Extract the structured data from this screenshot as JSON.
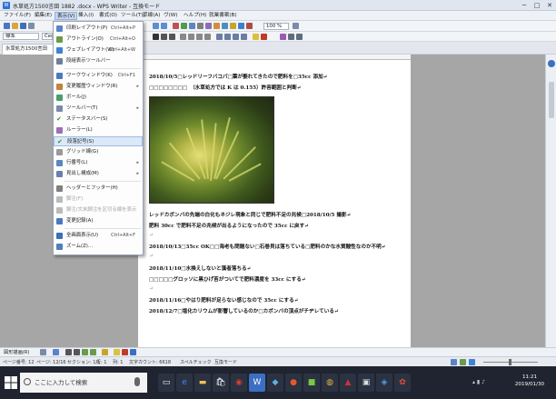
{
  "window": {
    "title": "水草処方1500言田 1882 .docx - WPS Writer - 互換モード",
    "controls": [
      "─",
      "□",
      "✕"
    ]
  },
  "menubar": {
    "items": [
      "ファイル(F)",
      "編集(E)",
      "表示(V)",
      "挿入(I)",
      "書式(O)",
      "ツール(T)",
      "罫線(A)",
      "ヴ(W)",
      "ヘルプ(H)",
      "就業書案(B)"
    ]
  },
  "toolbar": {
    "style_value": "標準",
    "font_value": "Cen",
    "zoom_value": "100 %"
  },
  "doc_tab": {
    "label": "水草処方1500言田"
  },
  "view_menu": {
    "items": [
      {
        "label": "印刷レイアウト(P)",
        "shortcut": "Ctrl+Alt+P",
        "icon_color": "#5b84c8"
      },
      {
        "label": "アウトライン(O)",
        "shortcut": "Ctrl+Alt+O",
        "icon_color": "#6a9a4a"
      },
      {
        "label": "ウェブレイアウト(W)",
        "shortcut": "Ctrl+Alt+W",
        "icon_color": "#3d83d4"
      },
      {
        "label": "段組表示ツールバー",
        "shortcut": "",
        "icon_color": "#6f7f99"
      },
      {
        "label": "ワークウィンドウ(K)",
        "shortcut": "Ctrl+F1",
        "icon_color": "#4a7ac0"
      },
      {
        "label": "変更履歴ウィンドウ(R)",
        "shortcut": "",
        "icon_color": "#c4823b",
        "submenu": true
      },
      {
        "label": "ボール(J)",
        "shortcut": "",
        "icon_color": "#4c9c6a"
      },
      {
        "label": "ツールバー(T)",
        "shortcut": "",
        "icon_color": "#7a8aa8",
        "submenu": true
      },
      {
        "label": "ステータスバー(S)",
        "shortcut": "",
        "icon_color": "#5c7bb5",
        "checked": true
      },
      {
        "label": "ルーラー(L)",
        "shortcut": "",
        "icon_color": "#9a6fb8"
      },
      {
        "label": "段落記号(S)",
        "shortcut": "",
        "icon_color": "#5e9e3c",
        "checked": true,
        "highlighted": true
      },
      {
        "label": "グリッド線(G)",
        "shortcut": "",
        "icon_color": "#999999"
      },
      {
        "label": "行番号(L)",
        "shortcut": "",
        "icon_color": "#5a86c2",
        "submenu": true
      },
      {
        "label": "見出し構成(M)",
        "shortcut": "",
        "icon_color": "#6a7fb0",
        "submenu": true
      },
      {
        "label": "ヘッダーとフッター(H)",
        "shortcut": "",
        "icon_color": "#808080"
      },
      {
        "label": "脚注(F)",
        "shortcut": "",
        "icon_color": "#bbbbbb",
        "disabled": true
      },
      {
        "label": "脚注/文末脚注を区切る線を表示",
        "shortcut": "",
        "icon_color": "#bbbbbb",
        "disabled": true
      },
      {
        "label": "変更記録(A)",
        "shortcut": "",
        "icon_color": "#4a78c2"
      },
      {
        "label": "全画面表示(U)",
        "shortcut": "Ctrl+Alt+F",
        "icon_color": "#3e6fb8"
      },
      {
        "label": "ズーム(Z)...",
        "shortcut": "",
        "icon_color": "#4f7fbf"
      }
    ]
  },
  "document": {
    "lines": [
      "2018/10/5□レッドリーフバコパ□葉が萎れてきたので肥料を□35cc 添加↵",
      "□□□□□□□□　（水草処方では K は 0.155）許容範囲と判断↵",
      "レッドカボンバの先端の白化もネジレ現象と同じで肥料不足の兆候□2018/10/5 撮影↵",
      "肥料 30cc で肥料不足の兆候が出るようになったので 35cc に戻す↵",
      "↵",
      "2018/10/13□35cc OK□□海老も問題ない□石巻貝は落ちている□肥料のかな水質酸性なのか不明↵",
      "↵",
      "2018/11/10□水換えしないと藻者落ちる↵",
      "□□□□□グロッソに黒ひげ苔がついてで肥料濃度を 33cc にする↵",
      "↵",
      "2018/11/16□やはり肥料が足らない感じなので 35cc にする↵",
      "2018/12/7□塩化カリウムが影響しているのか□カボンバの頂点がチヂレている↵"
    ]
  },
  "drawbar": {
    "label": "図形描画(R)"
  },
  "statusbar": {
    "items": [
      "ページ番号: 12",
      "ページ: 12/16",
      "セクション: 1/1",
      "行: 1",
      "列: 1",
      "文字カウント: 6618",
      "スペルチェック",
      "互換モード"
    ]
  },
  "taskbar": {
    "search_placeholder": "ここに入力して検索",
    "time": "11:21",
    "date": "2019/01/30"
  },
  "colors": {
    "accent": "#2f6fd6",
    "menu_highlight": "#dbe8f8",
    "taskbar": "#1f2430"
  }
}
